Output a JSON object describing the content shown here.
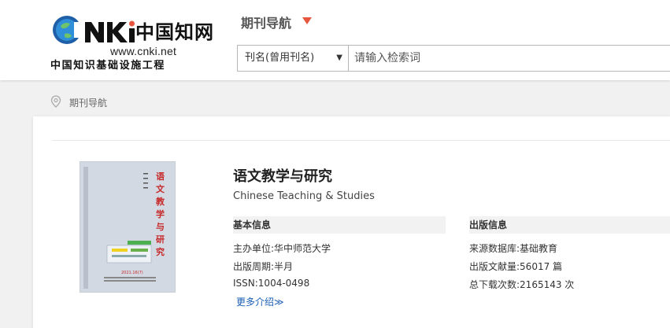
{
  "logo": {
    "brand": "CNKI中国知网",
    "url": "www.cnki.net",
    "subtitle": "中国知识基础设施工程"
  },
  "nav": {
    "title": "期刊导航"
  },
  "search": {
    "field_selected": "刊名(曾用刊名)",
    "placeholder": "请输入检索词"
  },
  "breadcrumb": {
    "label": "期刊导航"
  },
  "journal": {
    "title": "语文教学与研究",
    "title_en": "Chinese Teaching & Studies",
    "cover": {
      "title_vertical": "语文教学与研究",
      "year_issue": "2021.16(7)"
    },
    "basic_info": {
      "heading": "基本信息",
      "rows": [
        {
          "label": "主办单位:",
          "value": "华中师范大学"
        },
        {
          "label": "出版周期:",
          "value": "半月"
        },
        {
          "label": "ISSN:",
          "value": "1004-0498"
        }
      ]
    },
    "publication_info": {
      "heading": "出版信息",
      "rows": [
        {
          "label": "来源数据库:",
          "value": "基础教育"
        },
        {
          "label": "出版文献量:",
          "value": "56017 篇"
        },
        {
          "label": "总下载次数:",
          "value": "2165143 次"
        }
      ]
    },
    "more_label": "更多介绍"
  },
  "colors": {
    "accent_red": "#e8553e",
    "link_blue": "#1a5db4",
    "logo_blue": "#1f5fa8"
  }
}
